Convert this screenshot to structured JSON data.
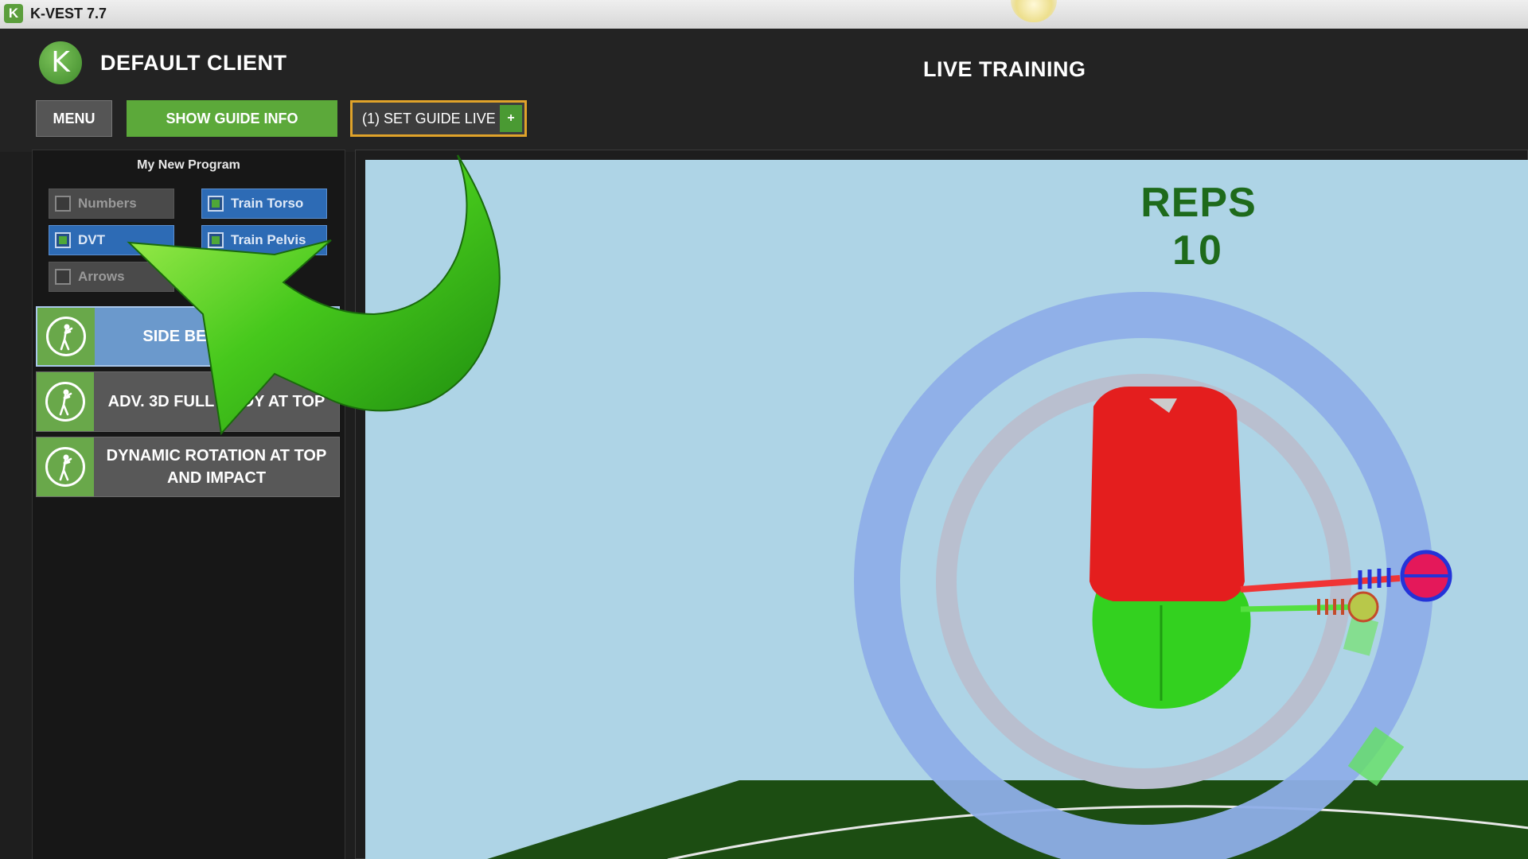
{
  "titlebar": {
    "title": "K-VEST 7.7",
    "icon": "k-logo-icon"
  },
  "header": {
    "logo_letter": "K",
    "client_name": "DEFAULT CLIENT",
    "page_title": "LIVE TRAINING"
  },
  "toolbar": {
    "menu_label": "MENU",
    "guide_info_label": "SHOW GUIDE INFO",
    "set_guide_live_label": "(1) SET GUIDE LIVE",
    "add_label": "+"
  },
  "sidebar": {
    "program_name": "My New Program",
    "options": [
      {
        "label": "Numbers",
        "checked": false
      },
      {
        "label": "Train Torso",
        "checked": true
      },
      {
        "label": "DVT",
        "checked": true
      },
      {
        "label": "Train Pelvis",
        "checked": true
      },
      {
        "label": "Arrows",
        "checked": false
      }
    ],
    "drills": [
      {
        "label": "SIDE BEND AT TOP",
        "active": true,
        "icon": "golfer-icon"
      },
      {
        "label": "ADV. 3D FULL BODY AT TOP",
        "active": false,
        "icon": "golfer-icon"
      },
      {
        "label": "DYNAMIC ROTATION AT TOP AND IMPACT",
        "active": false,
        "icon": "golfer-icon"
      }
    ]
  },
  "scene": {
    "reps_title": "REPS",
    "reps_value": "10",
    "colors": {
      "sky": "#aed4e6",
      "torso": "#e41e1e",
      "pelvis": "#33d11f",
      "outer_ring": "#8eaee8",
      "inner_ring": "#b9bfcf",
      "ground": "#1c4d12",
      "accent_orange": "#e0a32a",
      "brand_green": "#5ca93a"
    }
  },
  "overlay": {
    "annotation": "green-arrow-pointer"
  }
}
